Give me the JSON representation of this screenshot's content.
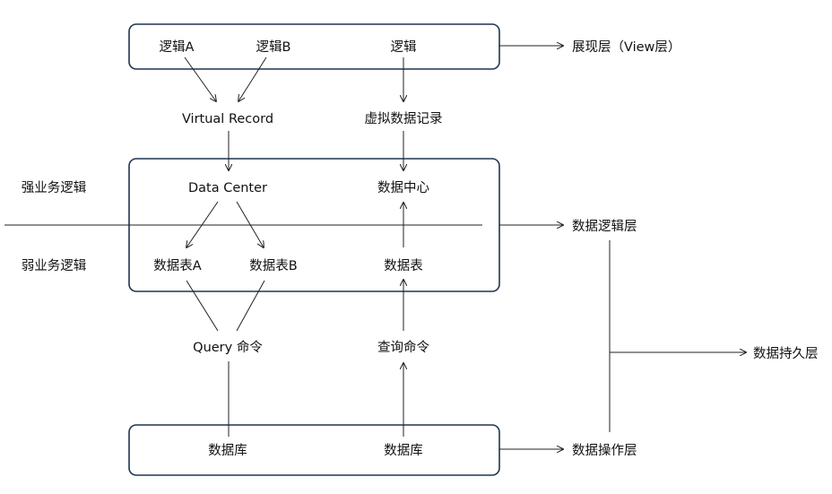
{
  "view_box": {
    "logic_a": "逻辑A",
    "logic_b": "逻辑B",
    "logic": "逻辑"
  },
  "virtual_record": "Virtual Record",
  "virtual_record_cn": "虚拟数据记录",
  "logic_box": {
    "data_center": "Data Center",
    "data_center_cn": "数据中心",
    "table_a": "数据表A",
    "table_b": "数据表B",
    "table": "数据表"
  },
  "strong_logic": "强业务逻辑",
  "weak_logic": "弱业务逻辑",
  "query_cmd": "Query 命令",
  "query_cmd_cn": "查询命令",
  "db_box": {
    "db_left": "数据库",
    "db_right": "数据库"
  },
  "layers": {
    "view": "展现层（View层）",
    "logic": "数据逻辑层",
    "operate": "数据操作层",
    "persist": "数据持久层"
  }
}
